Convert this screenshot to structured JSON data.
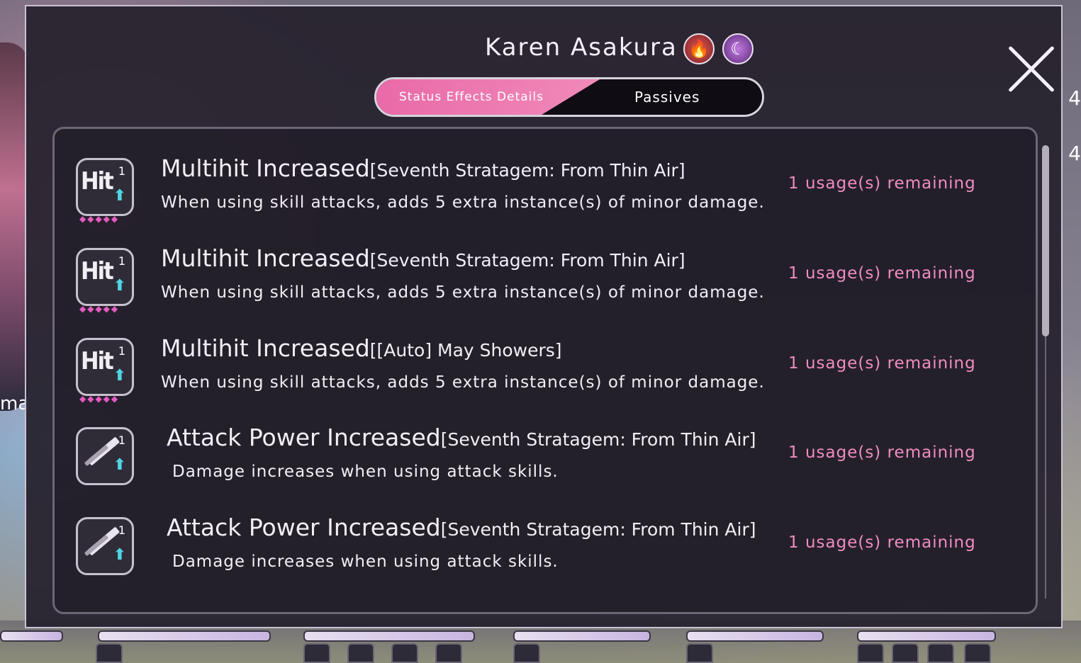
{
  "window": {
    "character_name": "Karen Asakura"
  },
  "elements": [
    {
      "icon": "fire-icon",
      "color": "#c93a3a"
    },
    {
      "icon": "moon-icon",
      "color": "#8a3fb0"
    }
  ],
  "tabs": [
    {
      "label": "Status Effects Details",
      "active": true
    },
    {
      "label": "Passives",
      "active": false
    }
  ],
  "effects": [
    {
      "icon": "multihit-icon",
      "icon_text": "Hit",
      "count": "1",
      "name": "Multihit Increased",
      "source": "[Seventh Stratagem: From Thin Air]",
      "description": "When using skill attacks, adds 5 extra instance(s) of minor damage.",
      "remaining": "1 usage(s) remaining"
    },
    {
      "icon": "multihit-icon",
      "icon_text": "Hit",
      "count": "1",
      "name": "Multihit Increased",
      "source": "[Seventh Stratagem: From Thin Air]",
      "description": "When using skill attacks, adds 5 extra instance(s) of minor damage.",
      "remaining": "1 usage(s) remaining"
    },
    {
      "icon": "multihit-icon",
      "icon_text": "Hit",
      "count": "1",
      "name": "Multihit Increased",
      "source": "[[Auto] May Showers]",
      "description": "When using skill attacks, adds 5 extra instance(s) of minor damage.",
      "remaining": "1 usage(s) remaining"
    },
    {
      "icon": "attack-up-icon",
      "icon_text": "",
      "count": "1",
      "name": "Attack Power Increased",
      "source": "[Seventh Stratagem: From Thin Air]",
      "description": "Damage increases when using attack skills.",
      "remaining": "1 usage(s) remaining"
    },
    {
      "icon": "attack-up-icon",
      "icon_text": "",
      "count": "1",
      "name": "Attack Power Increased",
      "source": "[Seventh Stratagem: From Thin Air]",
      "description": "Damage increases when using attack skills.",
      "remaining": "1 usage(s) remaining"
    }
  ],
  "background": {
    "left_text": "ma",
    "right_numbers": [
      "4",
      "4"
    ]
  },
  "colors": {
    "accent_pink": "#ef7fb4",
    "remaining_text": "#f08cc2",
    "buff_arrow": "#4fd5e2"
  }
}
